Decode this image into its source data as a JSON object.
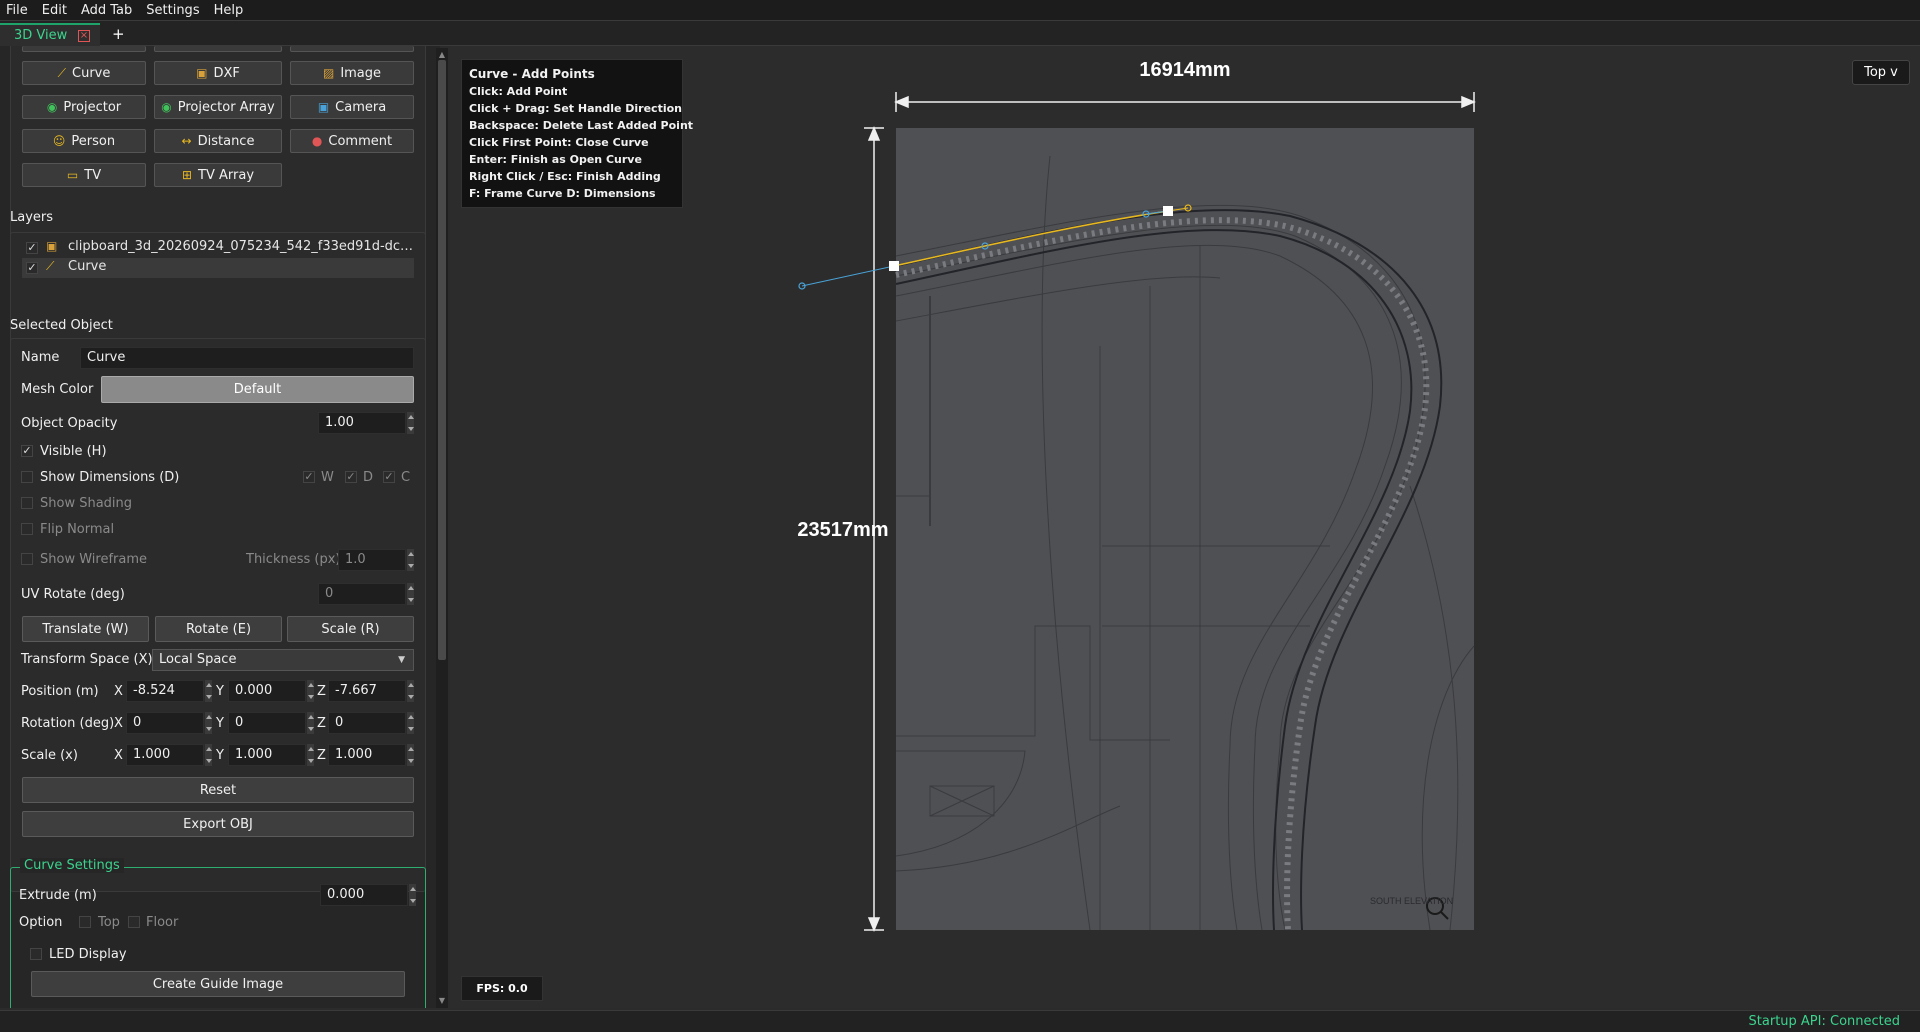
{
  "menu": [
    "File",
    "Edit",
    "Add Tab",
    "Settings",
    "Help"
  ],
  "tabs": {
    "active": "3D View",
    "add": "+"
  },
  "add_buttons": [
    {
      "label": "Curve",
      "icon": "curve-icon"
    },
    {
      "label": "DXF",
      "icon": "dxf-icon"
    },
    {
      "label": "Image",
      "icon": "image-icon"
    },
    {
      "label": "Projector",
      "icon": "projector-icon"
    },
    {
      "label": "Projector Array",
      "icon": "projector-array-icon"
    },
    {
      "label": "Camera",
      "icon": "camera-icon"
    },
    {
      "label": "Person",
      "icon": "person-icon"
    },
    {
      "label": "Distance",
      "icon": "distance-icon"
    },
    {
      "label": "Comment",
      "icon": "comment-icon"
    },
    {
      "label": "TV",
      "icon": "tv-icon"
    },
    {
      "label": "TV Array",
      "icon": "tv-array-icon"
    }
  ],
  "layers": {
    "title": "Layers",
    "items": [
      {
        "name": "clipboard_3d_20260924_075234_542_f33ed91d-dc…",
        "visible": true
      },
      {
        "name": "Curve",
        "visible": true
      }
    ]
  },
  "selected": {
    "title": "Selected Object",
    "name_label": "Name",
    "name_value": "Curve",
    "mesh_color_label": "Mesh Color",
    "mesh_color_value": "Default",
    "opacity_label": "Object Opacity",
    "opacity_value": "1.00",
    "visible_label": "Visible (H)",
    "show_dims_label": "Show Dimensions (D)",
    "dim_w": "W",
    "dim_d": "D",
    "dim_c": "C",
    "show_shading_label": "Show Shading",
    "flip_normal_label": "Flip Normal",
    "show_wireframe_label": "Show Wireframe",
    "thickness_label": "Thickness (px)",
    "thickness_value": "1.0",
    "uv_rotate_label": "UV Rotate (deg)",
    "uv_rotate_value": "0",
    "translate_label": "Translate (W)",
    "rotate_label": "Rotate (E)",
    "scale_label": "Scale (R)",
    "transform_space_label": "Transform Space (X)",
    "transform_space_value": "Local Space",
    "position_label": "Position (m)",
    "pos_x": "-8.524",
    "pos_y": "0.000",
    "pos_z": "-7.667",
    "rotation_label": "Rotation (deg)",
    "rot_x": "0",
    "rot_y": "0",
    "rot_z": "0",
    "scale_x_label": "Scale (x)",
    "sc_x": "1.000",
    "sc_y": "1.000",
    "sc_z": "1.000",
    "axis_x": "X",
    "axis_y": "Y",
    "axis_z": "Z",
    "reset_label": "Reset",
    "export_label": "Export OBJ"
  },
  "curve_settings": {
    "title": "Curve Settings",
    "extrude_label": "Extrude (m)",
    "extrude_value": "0.000",
    "option_label": "Option",
    "top_label": "Top",
    "floor_label": "Floor",
    "led_label": "LED Display",
    "guide_label": "Create Guide Image"
  },
  "viewport": {
    "hint_lines": [
      "Curve - Add Points",
      "Click: Add Point",
      "Click + Drag: Set Handle Direction",
      "Backspace: Delete Last Added Point",
      "Click First Point: Close Curve",
      "Enter: Finish as Open Curve",
      "Right Click / Esc: Finish Adding",
      "F: Frame Curve   D: Dimensions"
    ],
    "width_dim": "16914mm",
    "height_dim": "23517mm",
    "view_select": "Top v",
    "fps": "FPS: 0.0",
    "drawing_caption": "SOUTH ELEVATION"
  },
  "status": "Startup API: Connected",
  "colors": {
    "accent": "#3bd48e",
    "curve_yellow": "#e8b820",
    "handle_blue": "#4aa3d8"
  }
}
